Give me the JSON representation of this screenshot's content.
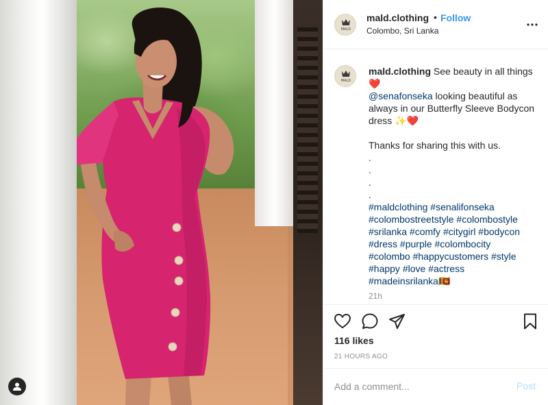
{
  "post": {
    "username": "mald.clothing",
    "follow_label": "Follow",
    "separator": "•",
    "location": "Colombo, Sri Lanka",
    "avatar_text": "MALD"
  },
  "caption": {
    "username": "mald.clothing",
    "line1": " See beauty in all things ",
    "heart": "❤️",
    "mention": "@senafonseka",
    "line2": " looking beautiful as always in our Butterfly Sleeve Bodycon dress ",
    "sparkle_heart": "✨❤️",
    "thanks": "Thanks for sharing this with us.",
    "dots": [
      ".",
      ".",
      ".",
      "."
    ],
    "hashtags": [
      "#maldclothing",
      "#senalifonseka",
      "#colombostreetstyle",
      "#colombostyle",
      "#srilanka",
      "#comfy",
      "#citygirl",
      "#bodycon",
      "#dress",
      "#purple",
      "#colombocity",
      "#colombo",
      "#happycustomers",
      "#style",
      "#happy",
      "#love",
      "#actress",
      "#madeinsrilanka🇱🇰"
    ],
    "relative_time": "21h"
  },
  "engagement": {
    "likes": "116 likes",
    "timestamp": "21 HOURS AGO"
  },
  "comment": {
    "placeholder": "Add a comment...",
    "post_label": "Post"
  },
  "colors": {
    "link": "#00376b",
    "follow": "#3897f0",
    "muted": "#8e8e8e",
    "post_disabled": "#b2dffc",
    "dress": "#d6246e"
  },
  "icons": [
    "heart-icon",
    "comment-icon",
    "share-icon",
    "bookmark-icon",
    "more-icon",
    "user-tag-icon"
  ]
}
